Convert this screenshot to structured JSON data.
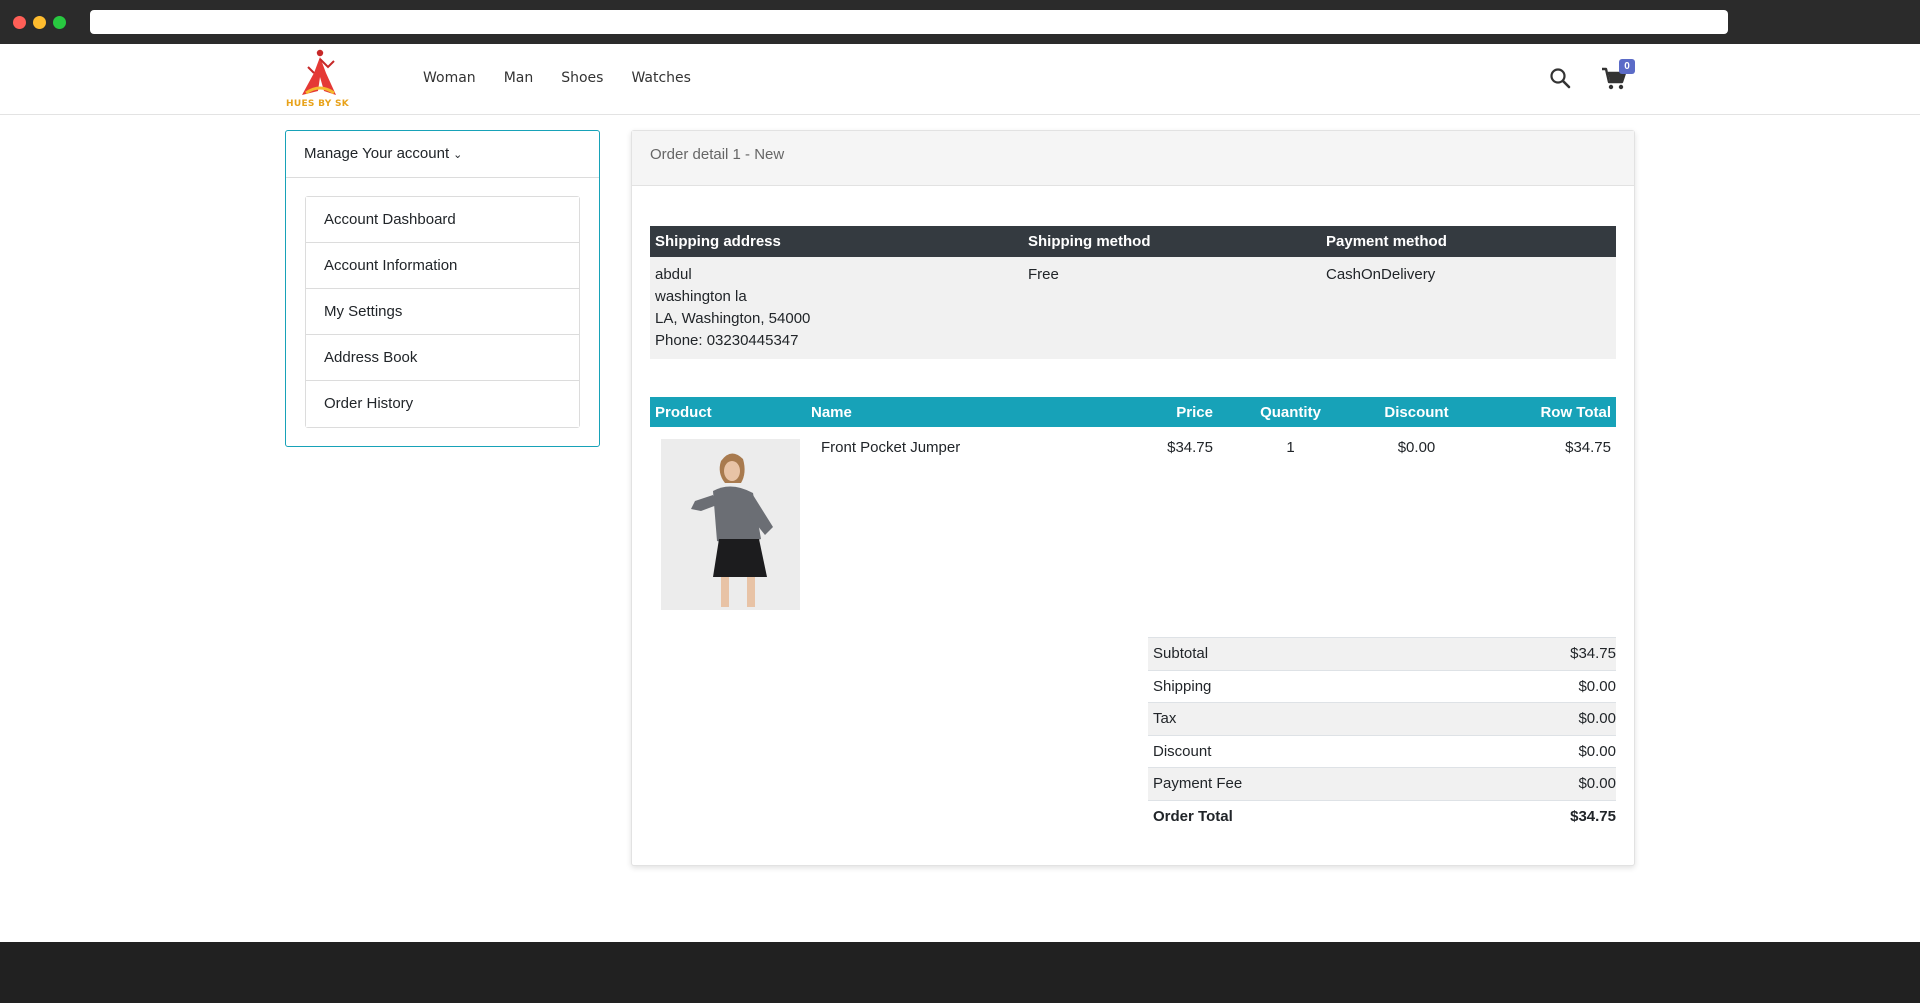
{
  "brand": {
    "logo_text": "HUES BY SK",
    "accent": "#17a2b8"
  },
  "nav": {
    "items": [
      "Woman",
      "Man",
      "Shoes",
      "Watches"
    ]
  },
  "cart": {
    "count": "0"
  },
  "sidebar": {
    "title": "Manage Your account",
    "items": [
      {
        "label": "Account Dashboard"
      },
      {
        "label": "Account Information"
      },
      {
        "label": "My Settings"
      },
      {
        "label": "Address Book"
      },
      {
        "label": "Order History"
      }
    ]
  },
  "order": {
    "title": "Order detail 1 - New",
    "shipping_table": {
      "headers": [
        "Shipping address",
        "Shipping method",
        "Payment method"
      ],
      "address": [
        "abdul",
        "washington la",
        "LA, Washington, 54000",
        "Phone: 03230445347"
      ],
      "shipping_method": "Free",
      "payment_method": "CashOnDelivery"
    },
    "products_table": {
      "headers": [
        "Product",
        "Name",
        "Price",
        "Quantity",
        "Discount",
        "Row Total"
      ],
      "rows": [
        {
          "name": "Front Pocket Jumper",
          "price": "$34.75",
          "quantity": "1",
          "discount": "$0.00",
          "row_total": "$34.75"
        }
      ]
    },
    "totals": [
      {
        "label": "Subtotal",
        "value": "$34.75"
      },
      {
        "label": "Shipping",
        "value": "$0.00"
      },
      {
        "label": "Tax",
        "value": "$0.00"
      },
      {
        "label": "Discount",
        "value": "$0.00"
      },
      {
        "label": "Payment Fee",
        "value": "$0.00"
      },
      {
        "label": "Order Total",
        "value": "$34.75"
      }
    ]
  }
}
